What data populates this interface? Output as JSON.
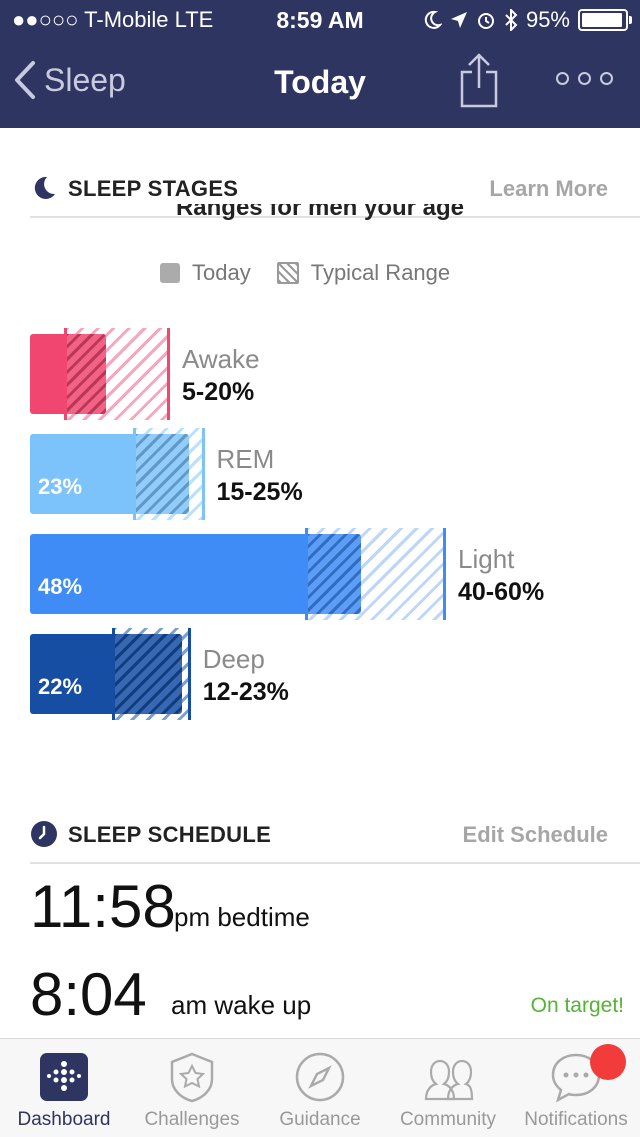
{
  "status": {
    "carrier": "●●○○○ T-Mobile  LTE",
    "time": "8:59 AM",
    "battery": "95%",
    "battery_level": 0.95
  },
  "nav": {
    "back_label": "Sleep",
    "title": "Today"
  },
  "stages": {
    "header": "SLEEP STAGES",
    "learn_more": "Learn More",
    "ranges_title": "Ranges for men your age",
    "legend_today": "Today",
    "legend_typical": "Typical Range",
    "items": [
      {
        "name": "Awake",
        "range": "5-20%",
        "today_pct": "",
        "today_value": 11,
        "range_min": 5,
        "range_max": 20,
        "color": "#f0466f",
        "tint": "#f7a7bb"
      },
      {
        "name": "REM",
        "range": "15-25%",
        "today_pct": "23%",
        "today_value": 23,
        "range_min": 15,
        "range_max": 25,
        "color": "#7dc3fb",
        "tint": "#b9e0fd"
      },
      {
        "name": "Light",
        "range": "40-60%",
        "today_pct": "48%",
        "today_value": 48,
        "range_min": 40,
        "range_max": 60,
        "color": "#3f8cf6",
        "tint": "#bcd7fb"
      },
      {
        "name": "Deep",
        "range": "12-23%",
        "today_pct": "22%",
        "today_value": 22,
        "range_min": 12,
        "range_max": 23,
        "color": "#154ea3",
        "tint": "#7c9fd2"
      }
    ]
  },
  "schedule": {
    "header": "SLEEP SCHEDULE",
    "edit": "Edit Schedule",
    "bedtime_time": "11:58",
    "bedtime_label": "pm bedtime",
    "wake_time": "8:04",
    "wake_label": "am wake up",
    "on_target": "On target!"
  },
  "tabs": [
    {
      "label": "Dashboard",
      "icon": "dashboard-icon"
    },
    {
      "label": "Challenges",
      "icon": "star-badge-icon"
    },
    {
      "label": "Guidance",
      "icon": "compass-icon"
    },
    {
      "label": "Community",
      "icon": "people-icon"
    },
    {
      "label": "Notifications",
      "icon": "chat-bubble-icon"
    }
  ]
}
